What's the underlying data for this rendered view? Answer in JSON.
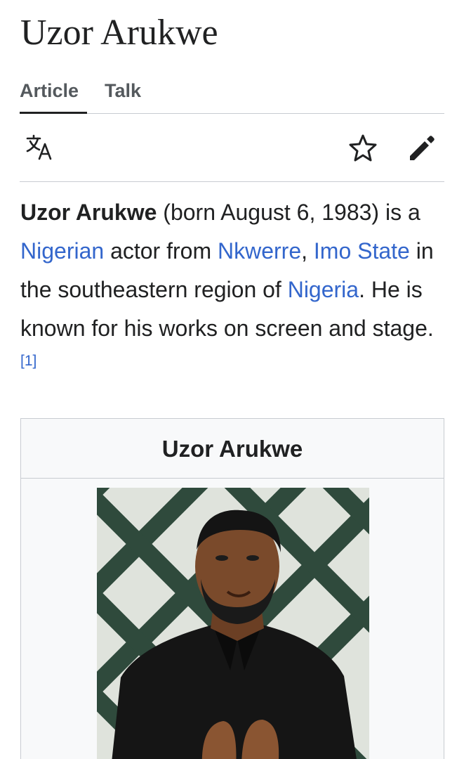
{
  "page": {
    "title": "Uzor Arukwe"
  },
  "tabs": [
    {
      "label": "Article",
      "active": true
    },
    {
      "label": "Talk",
      "active": false
    }
  ],
  "toolbar": {
    "icons": [
      "language-icon",
      "star-icon",
      "edit-pencil-icon"
    ]
  },
  "lead": {
    "subject": "Uzor Arukwe",
    "t1": " (born August 6, 1983) is a ",
    "link_nigerian": "Nigerian",
    "t2": " actor from ",
    "link_nkwerre": "Nkwerre",
    "t3": ", ",
    "link_imo_state": "Imo State",
    "t4": " in the southeastern region of ",
    "link_nigeria": "Nigeria",
    "t5": ". He is known for his works on screen and stage.",
    "ref": "[1]"
  },
  "infobox": {
    "title": "Uzor Arukwe",
    "image_icon": "portrait-photo"
  },
  "colors": {
    "link": "#3366cc",
    "text": "#202122",
    "muted": "#54595d",
    "border": "#c8ccd1",
    "infobox_bg": "#f8f9fa"
  }
}
